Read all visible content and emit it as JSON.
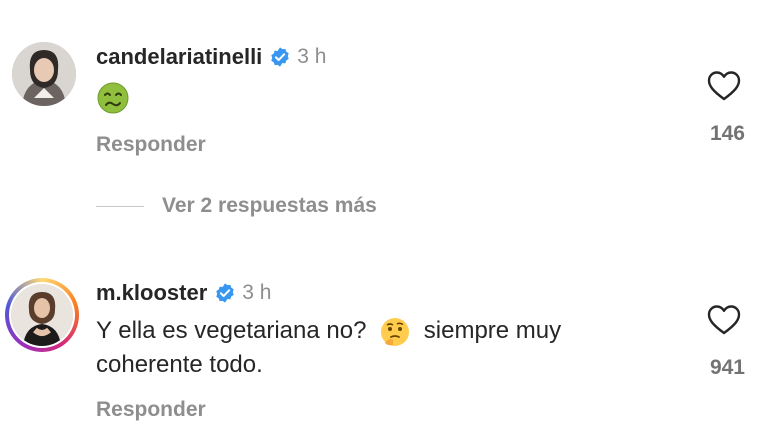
{
  "comments": [
    {
      "username": "candelariatinelli",
      "time": "3 h",
      "text": "",
      "reply_label": "Responder",
      "likes": "146",
      "emoji": "nauseated-face"
    },
    {
      "username": "m.klooster",
      "time": "3 h",
      "text_part1": "Y ella es vegetariana no?",
      "text_part2": "siempre muy coherente todo.",
      "reply_label": "Responder",
      "likes": "941",
      "emoji": "thinking-face"
    }
  ],
  "view_more_replies": "Ver 2 respuestas más",
  "colors": {
    "verified": "#3897f0",
    "secondary_text": "#8e8e8e",
    "primary_text": "#262626"
  }
}
